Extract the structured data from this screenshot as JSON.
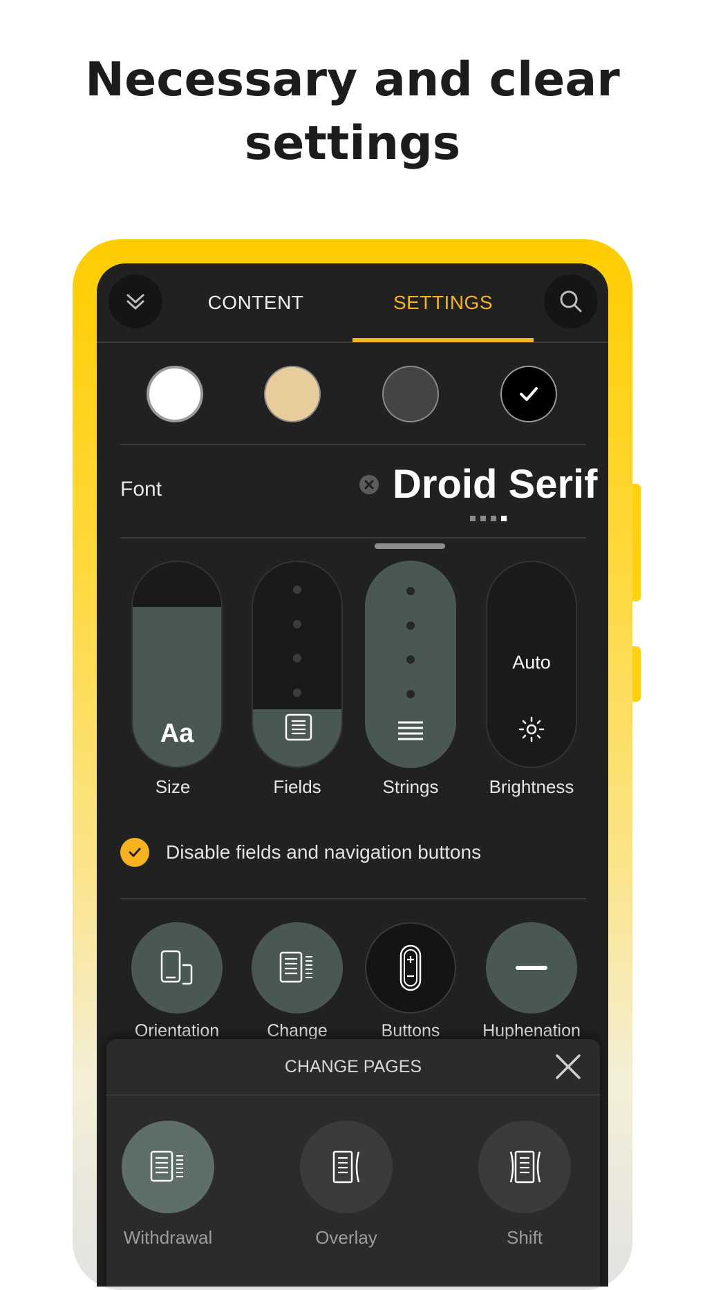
{
  "headline": {
    "line1": "Necessary and clear",
    "line2": "settings"
  },
  "colors": {
    "accent": "#f6b321",
    "frame": "#ffcc00",
    "screen_bg": "#212121",
    "active_control": "#4a5855"
  },
  "topbar": {
    "collapse_icon": "double-chevron-down-icon",
    "tabs": [
      {
        "label": "CONTENT",
        "active": false
      },
      {
        "label": "SETTINGS",
        "active": true
      }
    ],
    "search_icon": "search-icon"
  },
  "themes": [
    {
      "name": "white",
      "color": "#ffffff",
      "selected": false
    },
    {
      "name": "sepia",
      "color": "#e8cc9c",
      "selected": false
    },
    {
      "name": "dark-gray",
      "color": "#444444",
      "selected": false
    },
    {
      "name": "black",
      "color": "#000000",
      "selected": true
    }
  ],
  "font": {
    "label": "Font",
    "value": "Droid Serif",
    "page_count": 4,
    "active_page": 4
  },
  "sliders": [
    {
      "label": "Size",
      "icon": "font-size-icon",
      "glyph": "Aa",
      "level": 0.78
    },
    {
      "label": "Fields",
      "icon": "page-margins-icon",
      "level": 0.28
    },
    {
      "label": "Strings",
      "icon": "line-spacing-icon",
      "level": 1.0
    },
    {
      "label": "Brightness",
      "icon": "brightness-icon",
      "value_text": "Auto",
      "level": 0.0
    }
  ],
  "checkbox": {
    "label": "Disable fields and navigation buttons",
    "checked": true
  },
  "round_buttons": [
    {
      "label": "Orientation",
      "icon": "orientation-icon"
    },
    {
      "label": "Change",
      "icon": "page-change-icon"
    },
    {
      "label": "Buttons",
      "icon": "volume-buttons-icon"
    },
    {
      "label": "Huphenation",
      "icon": "hyphen-icon"
    }
  ],
  "change_pages_panel": {
    "title": "CHANGE PAGES",
    "close_icon": "close-icon",
    "options": [
      {
        "label": "Withdrawal",
        "icon": "withdrawal-icon",
        "selected": true
      },
      {
        "label": "Overlay",
        "icon": "overlay-icon",
        "selected": false
      },
      {
        "label": "Shift",
        "icon": "shift-icon",
        "selected": false
      }
    ]
  }
}
